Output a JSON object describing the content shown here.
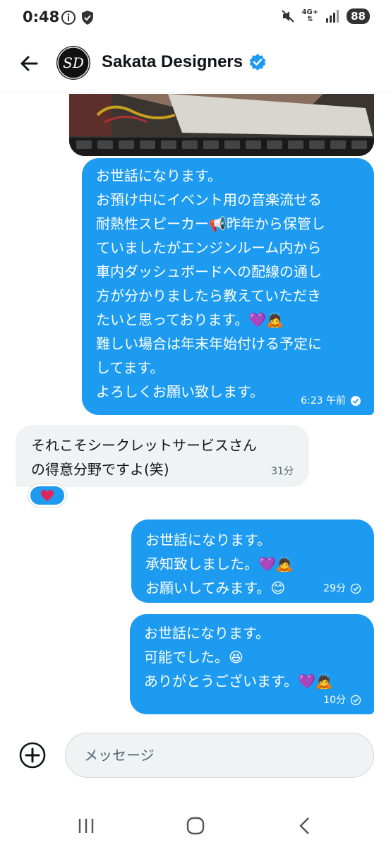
{
  "status_bar": {
    "time": "0:48",
    "network": "4G+",
    "battery": "88",
    "icons": [
      "info-icon",
      "shield-icon",
      "mute-icon",
      "signal-icon"
    ]
  },
  "header": {
    "title": "Sakata Designers",
    "avatar_text": "SD",
    "verified": true
  },
  "messages": [
    {
      "direction": "outgoing",
      "lines": [
        "お世話になります。",
        "お預け中にイベント用の音楽流せる",
        "耐熱性スピーカー📢昨年から保管し",
        "ていましたがエンジンルーム内から",
        "車内ダッシュボードへの配線の通し",
        "方が分かりましたら教えていただき",
        "たいと思っております。💜🙇",
        "難しい場合は年末年始付ける予定に",
        "してます。",
        "よろしくお願い致します。"
      ],
      "time": "6:23 午前"
    },
    {
      "direction": "incoming",
      "lines": [
        "それこそシークレットサービスさん",
        "の得意分野ですよ(笑)"
      ],
      "time": "31分",
      "reaction": "heart"
    },
    {
      "direction": "outgoing",
      "lines": [
        "お世話になります。",
        "承知致しました。💜🙇",
        "お願いしてみます。😊"
      ],
      "time": "29分"
    },
    {
      "direction": "outgoing",
      "lines": [
        "お世話になります。",
        "可能でした。😆",
        "ありがとうございます。💜🙇"
      ],
      "time": "10分"
    }
  ],
  "composer": {
    "placeholder": "メッセージ"
  },
  "colors": {
    "accent": "#1d9bf0",
    "incoming_bg": "#eff3f4",
    "heart": "#e0245e"
  }
}
